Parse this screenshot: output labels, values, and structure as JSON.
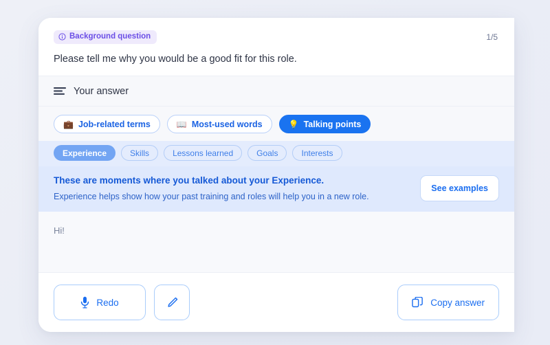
{
  "question": {
    "badge_label": "Background question",
    "badge_icon": "info-circle-icon",
    "page_counter": "1/5",
    "text": "Please tell me why you would be a good fit for this role."
  },
  "answer_header": {
    "icon": "text-lines-icon",
    "label": "Your answer"
  },
  "tabs": [
    {
      "label": "Job-related terms",
      "emoji": "💼",
      "icon": "briefcase-icon",
      "active": false
    },
    {
      "label": "Most-used words",
      "emoji": "📖",
      "icon": "open-book-icon",
      "active": false
    },
    {
      "label": "Talking points",
      "emoji": "💡",
      "icon": "lightbulb-icon",
      "active": true
    }
  ],
  "chips": [
    {
      "label": "Experience",
      "selected": true
    },
    {
      "label": "Skills",
      "selected": false
    },
    {
      "label": "Lessons learned",
      "selected": false
    },
    {
      "label": "Goals",
      "selected": false
    },
    {
      "label": "Interests",
      "selected": false
    }
  ],
  "info_banner": {
    "title": "These are moments where you talked about your Experience.",
    "subtitle": "Experience helps show how your past training and roles will help you in a new role.",
    "button_label": "See examples"
  },
  "answer": {
    "value": "Hi!"
  },
  "footer": {
    "redo_label": "Redo",
    "redo_icon": "microphone-icon",
    "edit_icon": "pencil-icon",
    "copy_label": "Copy answer",
    "copy_icon": "copy-icon"
  },
  "colors": {
    "accent_blue": "#1a73f0",
    "badge_purple": "#6b4ee6",
    "banner_blue": "#dfe9fd",
    "chip_row_blue": "#e4ecfd",
    "page_background": "#eef0f7"
  }
}
